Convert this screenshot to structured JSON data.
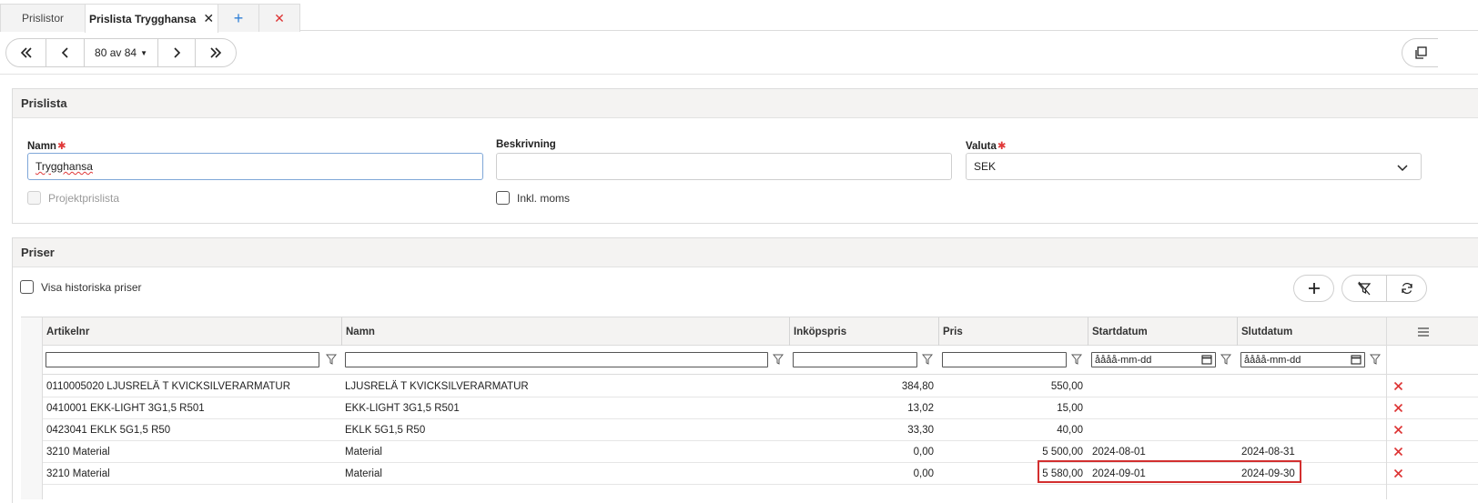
{
  "tabs": [
    {
      "label": "Prislistor"
    },
    {
      "label": "Prislista Trygghansa"
    }
  ],
  "nav": {
    "counter": "80 av 84"
  },
  "prislista": {
    "title": "Prislista",
    "namn_label": "Namn",
    "namn_value": "Trygghansa",
    "beskrivning_label": "Beskrivning",
    "beskrivning_value": "",
    "valuta_label": "Valuta",
    "valuta_value": "SEK",
    "projektprislista_label": "Projektprislista",
    "inkl_moms_label": "Inkl. moms"
  },
  "priser": {
    "title": "Priser",
    "visa_historiska_label": "Visa historiska priser",
    "columns": {
      "artikelnr": "Artikelnr",
      "namn": "Namn",
      "inkopspris": "Inköpspris",
      "pris": "Pris",
      "startdatum": "Startdatum",
      "slutdatum": "Slutdatum"
    },
    "date_placeholder": "åååå-mm-dd",
    "rows": [
      {
        "artikelnr": "0110005020 LJUSRELÄ T KVICKSILVERARMATUR",
        "namn": "LJUSRELÄ T KVICKSILVERARMATUR",
        "inkopspris": "384,80",
        "pris": "550,00",
        "start": "",
        "slut": ""
      },
      {
        "artikelnr": "0410001 EKK-LIGHT 3G1,5 R501",
        "namn": "EKK-LIGHT 3G1,5 R501",
        "inkopspris": "13,02",
        "pris": "15,00",
        "start": "",
        "slut": ""
      },
      {
        "artikelnr": "0423041 EKLK 5G1,5 R50",
        "namn": "EKLK 5G1,5 R50",
        "inkopspris": "33,30",
        "pris": "40,00",
        "start": "",
        "slut": ""
      },
      {
        "artikelnr": "3210 Material",
        "namn": "Material",
        "inkopspris": "0,00",
        "pris": "5 500,00",
        "start": "2024-08-01",
        "slut": "2024-08-31"
      },
      {
        "artikelnr": "3210 Material",
        "namn": "Material",
        "inkopspris": "0,00",
        "pris": "5 580,00",
        "start": "2024-09-01",
        "slut": "2024-09-30"
      }
    ]
  },
  "colors": {
    "accent": "#2f7fd6",
    "danger": "#d33333",
    "highlight_box": "#d32f2f",
    "panel_header": "#f4f3f2"
  },
  "icons": [
    "first-page-icon",
    "prev-icon",
    "next-icon",
    "last-page-icon",
    "copy-icon",
    "close-icon",
    "plus-icon",
    "filter-icon",
    "clear-filter-icon",
    "refresh-icon",
    "chevron-down-icon",
    "calendar-icon",
    "delete-icon",
    "column-menu-icon"
  ]
}
